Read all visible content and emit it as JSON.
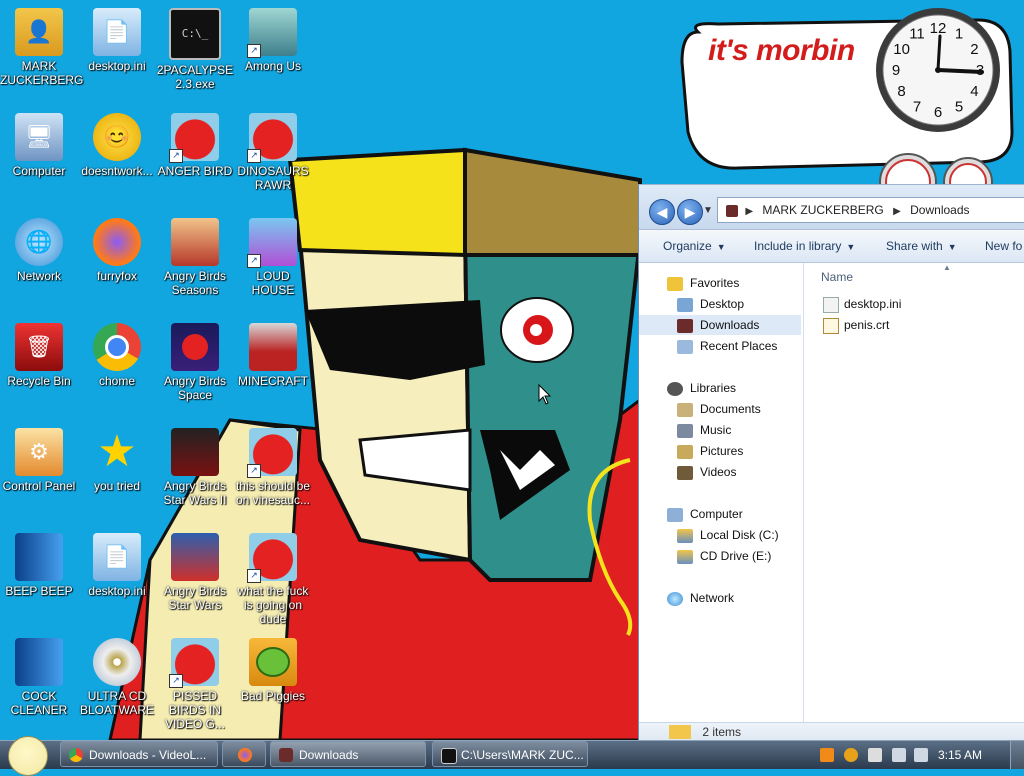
{
  "desktop": {
    "icons": [
      {
        "label": "MARK ZUCKERBERG",
        "icon": "user-folder-icon"
      },
      {
        "label": "desktop.ini",
        "icon": "config-file-icon"
      },
      {
        "label": "2PACALYPSE 2.3.exe",
        "icon": "console-exe-icon"
      },
      {
        "label": "Among Us",
        "icon": "among-us-icon"
      },
      {
        "label": "Computer",
        "icon": "computer-icon"
      },
      {
        "label": "doesntwork...",
        "icon": "yahoo-messenger-icon"
      },
      {
        "label": "ANGER BIRD",
        "icon": "angry-bird-icon"
      },
      {
        "label": "DINOSAURS RAWR",
        "icon": "angry-bird-icon"
      },
      {
        "label": "Network",
        "icon": "network-globe-icon"
      },
      {
        "label": "furryfox",
        "icon": "firefox-icon"
      },
      {
        "label": "Angry Birds Seasons",
        "icon": "angry-birds-seasons-icon"
      },
      {
        "label": "LOUD HOUSE",
        "icon": "loud-house-icon"
      },
      {
        "label": "Recycle Bin",
        "icon": "recycle-bin-icon"
      },
      {
        "label": "chome",
        "icon": "chrome-icon"
      },
      {
        "label": "Angry Birds Space",
        "icon": "angry-birds-space-icon"
      },
      {
        "label": "MINECRAFT",
        "icon": "minecraft-icon"
      },
      {
        "label": "Control Panel",
        "icon": "control-panel-icon"
      },
      {
        "label": "you tried",
        "icon": "gold-star-icon"
      },
      {
        "label": "Angry Birds Star Wars II",
        "icon": "angry-birds-star-wars-ii-icon"
      },
      {
        "label": "this should be on vinesauc...",
        "icon": "angry-bird-icon"
      },
      {
        "label": "BEEP BEEP",
        "icon": "blue-book-icon"
      },
      {
        "label": "desktop.ini",
        "icon": "config-file-icon"
      },
      {
        "label": "Angry Birds Star Wars",
        "icon": "angry-birds-star-wars-icon"
      },
      {
        "label": "what the fuck is going on dude",
        "icon": "angry-bird-icon"
      },
      {
        "label": "COCK CLEANER",
        "icon": "blue-book-icon"
      },
      {
        "label": "ULTRA CD BLOATWARE",
        "icon": "cd-disc-icon"
      },
      {
        "label": "PISSED BIRDS IN VIDEO G...",
        "icon": "angry-bird-icon"
      },
      {
        "label": "Bad Piggies",
        "icon": "bad-piggies-icon"
      }
    ]
  },
  "gadget": {
    "bubble_text": "it's morbin",
    "clock_numerals": [
      "12",
      "1",
      "2",
      "3",
      "4",
      "5",
      "6",
      "7",
      "8",
      "9",
      "10",
      "11"
    ]
  },
  "explorer": {
    "breadcrumb": [
      "MARK ZUCKERBERG",
      "Downloads"
    ],
    "toolbar": {
      "organize": "Organize",
      "include_in_library": "Include in library",
      "share_with": "Share with",
      "new_folder": "New fo"
    },
    "nav": {
      "favorites": "Favorites",
      "desktop": "Desktop",
      "downloads": "Downloads",
      "recent_places": "Recent Places",
      "libraries": "Libraries",
      "documents": "Documents",
      "music": "Music",
      "pictures": "Pictures",
      "videos": "Videos",
      "computer": "Computer",
      "local_disk": "Local Disk (C:)",
      "cd_drive": "CD Drive (E:)",
      "network": "Network"
    },
    "column_name": "Name",
    "files": [
      "desktop.ini",
      "penis.crt"
    ],
    "status": "2 items"
  },
  "taskbar": {
    "buttons": [
      {
        "label": "Downloads - VideoL..."
      },
      {
        "label": "Downloads"
      },
      {
        "label": "C:\\Users\\MARK ZUC..."
      }
    ],
    "time": "3:15 AM"
  },
  "colors": {
    "desktop_bg": "#12a6e0",
    "bubble_text": "#d31c1c",
    "taskbar": "#3a4b5e"
  }
}
